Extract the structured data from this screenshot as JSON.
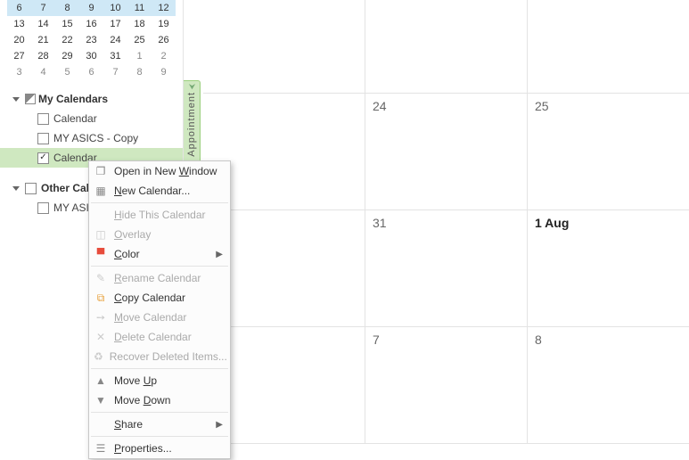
{
  "mini_calendar": {
    "rows": [
      {
        "cells": [
          "6",
          "7",
          "8",
          "9",
          "10",
          "11",
          "12"
        ],
        "highlight": true
      },
      {
        "cells": [
          "13",
          "14",
          "15",
          "16",
          "17",
          "18",
          "19"
        ]
      },
      {
        "cells": [
          "20",
          "21",
          "22",
          "23",
          "24",
          "25",
          "26"
        ]
      },
      {
        "cells": [
          "27",
          "28",
          "29",
          "30",
          "31",
          "1",
          "2"
        ],
        "dim_from": 5
      },
      {
        "cells": [
          "3",
          "4",
          "5",
          "6",
          "7",
          "8",
          "9"
        ],
        "dim_from": 0
      }
    ]
  },
  "sidebar": {
    "groups": [
      {
        "label": "My Calendars",
        "items": [
          {
            "label": "Calendar",
            "checked": false
          },
          {
            "label": "MY ASICS - Copy",
            "checked": false
          },
          {
            "label": "Calendar",
            "checked": true,
            "selected": true
          }
        ]
      },
      {
        "label": "Other Calendars",
        "items": [
          {
            "label": "MY ASICS",
            "checked": false
          }
        ]
      }
    ]
  },
  "appt_tab": "Appointment",
  "grid": [
    [
      "",
      "",
      ""
    ],
    [
      "",
      "24",
      "25"
    ],
    [
      "",
      "31",
      "1 Aug"
    ],
    [
      "",
      "7",
      "8"
    ]
  ],
  "grid_strong": [
    "1 Aug"
  ],
  "context_menu": [
    {
      "icon": "window",
      "label": "Open in New Window",
      "u": 12,
      "enabled": true
    },
    {
      "icon": "grid",
      "label": "New Calendar...",
      "u": 0,
      "enabled": true
    },
    {
      "sep": true
    },
    {
      "icon": "",
      "label": "Hide This Calendar",
      "u": 0,
      "enabled": false
    },
    {
      "icon": "overlay",
      "label": "Overlay",
      "u": 0,
      "enabled": false
    },
    {
      "icon": "color",
      "label": "Color",
      "u": 0,
      "enabled": true,
      "submenu": true
    },
    {
      "sep": true
    },
    {
      "icon": "rename",
      "label": "Rename Calendar",
      "u": 0,
      "enabled": false
    },
    {
      "icon": "copy",
      "label": "Copy Calendar",
      "u": 0,
      "enabled": true
    },
    {
      "icon": "move",
      "label": "Move Calendar",
      "u": 0,
      "enabled": false
    },
    {
      "icon": "delete",
      "label": "Delete Calendar",
      "u": 0,
      "enabled": false
    },
    {
      "icon": "recover",
      "label": "Recover Deleted Items...",
      "u": -1,
      "enabled": false
    },
    {
      "sep": true
    },
    {
      "icon": "up",
      "label": "Move Up",
      "u": 5,
      "enabled": true
    },
    {
      "icon": "down",
      "label": "Move Down",
      "u": 5,
      "enabled": true
    },
    {
      "sep": true
    },
    {
      "icon": "",
      "label": "Share",
      "u": 0,
      "enabled": true,
      "submenu": true
    },
    {
      "sep": true
    },
    {
      "icon": "props",
      "label": "Properties...",
      "u": 0,
      "enabled": true
    }
  ],
  "icon_glyph": {
    "window": "❐",
    "grid": "▦",
    "overlay": "◫",
    "color": "▀",
    "rename": "✎",
    "copy": "⧉",
    "move": "➙",
    "delete": "✕",
    "recover": "♻",
    "up": "▲",
    "down": "▼",
    "props": "☰"
  },
  "icon_color": {
    "copy": "#e7a13c",
    "color": "#e74c3c"
  }
}
